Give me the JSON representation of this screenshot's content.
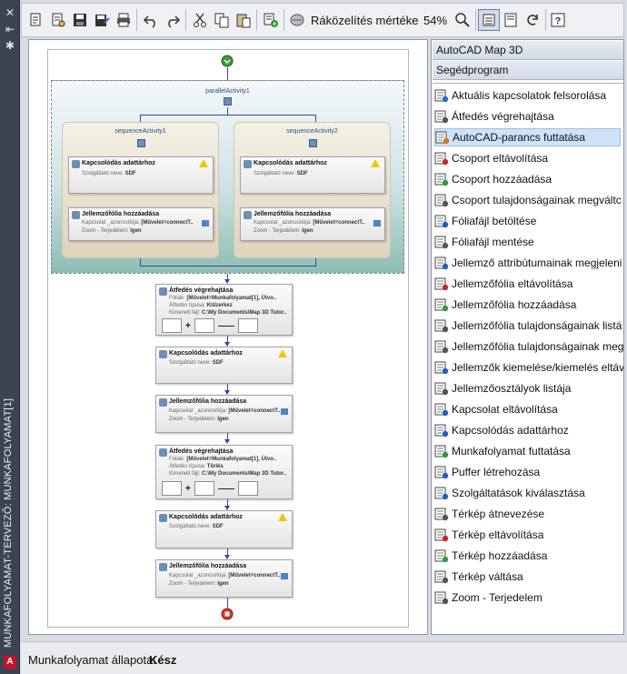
{
  "window": {
    "title": "MUNKAFOLYAMAT-TERVEZŐ: MUNKAFOLYAMAT[1]"
  },
  "toolbar": {
    "zoom_label": "Ráközelítés mértéke",
    "zoom_value": "54%"
  },
  "designer": {
    "parallel_label": "parallelActivity1",
    "seq1_label": "sequenceActivity1",
    "seq2_label": "sequenceActivity2",
    "kapcs_title": "Kapcsolódás adattárhoz",
    "szolg_label": "Szolgáltató neve:",
    "szolg_value": "SDF",
    "jell_title": "Jellemzőfólia hozzáadása",
    "kapcs_azon_label": "Kapcsolat _azonosítója:",
    "kapcs_azon_value": "[Művelet=connectT..",
    "zoom_label": "Zoom - Terjedelem:",
    "zoom_value": "Igen",
    "atf_title": "Átfedés végrehajtása",
    "foliak_label": "Fóliák:",
    "foliak_value": "[Művelet=Munkafolyamat[1], Ütvo..",
    "atf_tipus_label": "Átfedés típusa:",
    "atf_tipus_value1": "Kiűzerkez",
    "atf_tipus_value2": "Törlés",
    "kimeneti_label": "Kimeneti fájl:",
    "kimeneti_value": "C:\\My Documents\\Map 3D Tutor.."
  },
  "panel": {
    "header": "AutoCAD Map 3D",
    "subheader": "Segédprogram",
    "items": [
      "Aktuális kapcsolatok felsorolása",
      "Átfedés végrehajtása",
      "AutoCAD-parancs futtatása",
      "Csoport eltávolítása",
      "Csoport hozzáadása",
      "Csoport tulajdonságainak megváltc",
      "Fóliafájl betöltése",
      "Fóliafájl mentése",
      "Jellemző attribútumainak megjeleni",
      "Jellemzőfólia eltávolítása",
      "Jellemzőfólia hozzáadása",
      "Jellemzőfólia tulajdonságainak listá",
      "Jellemzőfólia tulajdonságainak meg",
      "Jellemzők kiemelése/kiemelés eltáv",
      "Jellemzőosztályok listája",
      "Kapcsolat eltávolítása",
      "Kapcsolódás adattárhoz",
      "Munkafolyamat futtatása",
      "Puffer létrehozása",
      "Szolgáltatások kiválasztása",
      "Térkép átnevezése",
      "Térkép eltávolítása",
      "Térkép hozzáadása",
      "Térkép váltása",
      "Zoom - Terjedelem"
    ],
    "selected_index": 2
  },
  "status": {
    "label": "Munkafolyamat állapota:",
    "value": "Kész"
  },
  "colors": {
    "accent": "#35469c",
    "selection": "#cfe2f7",
    "warning": "#f2c500"
  }
}
